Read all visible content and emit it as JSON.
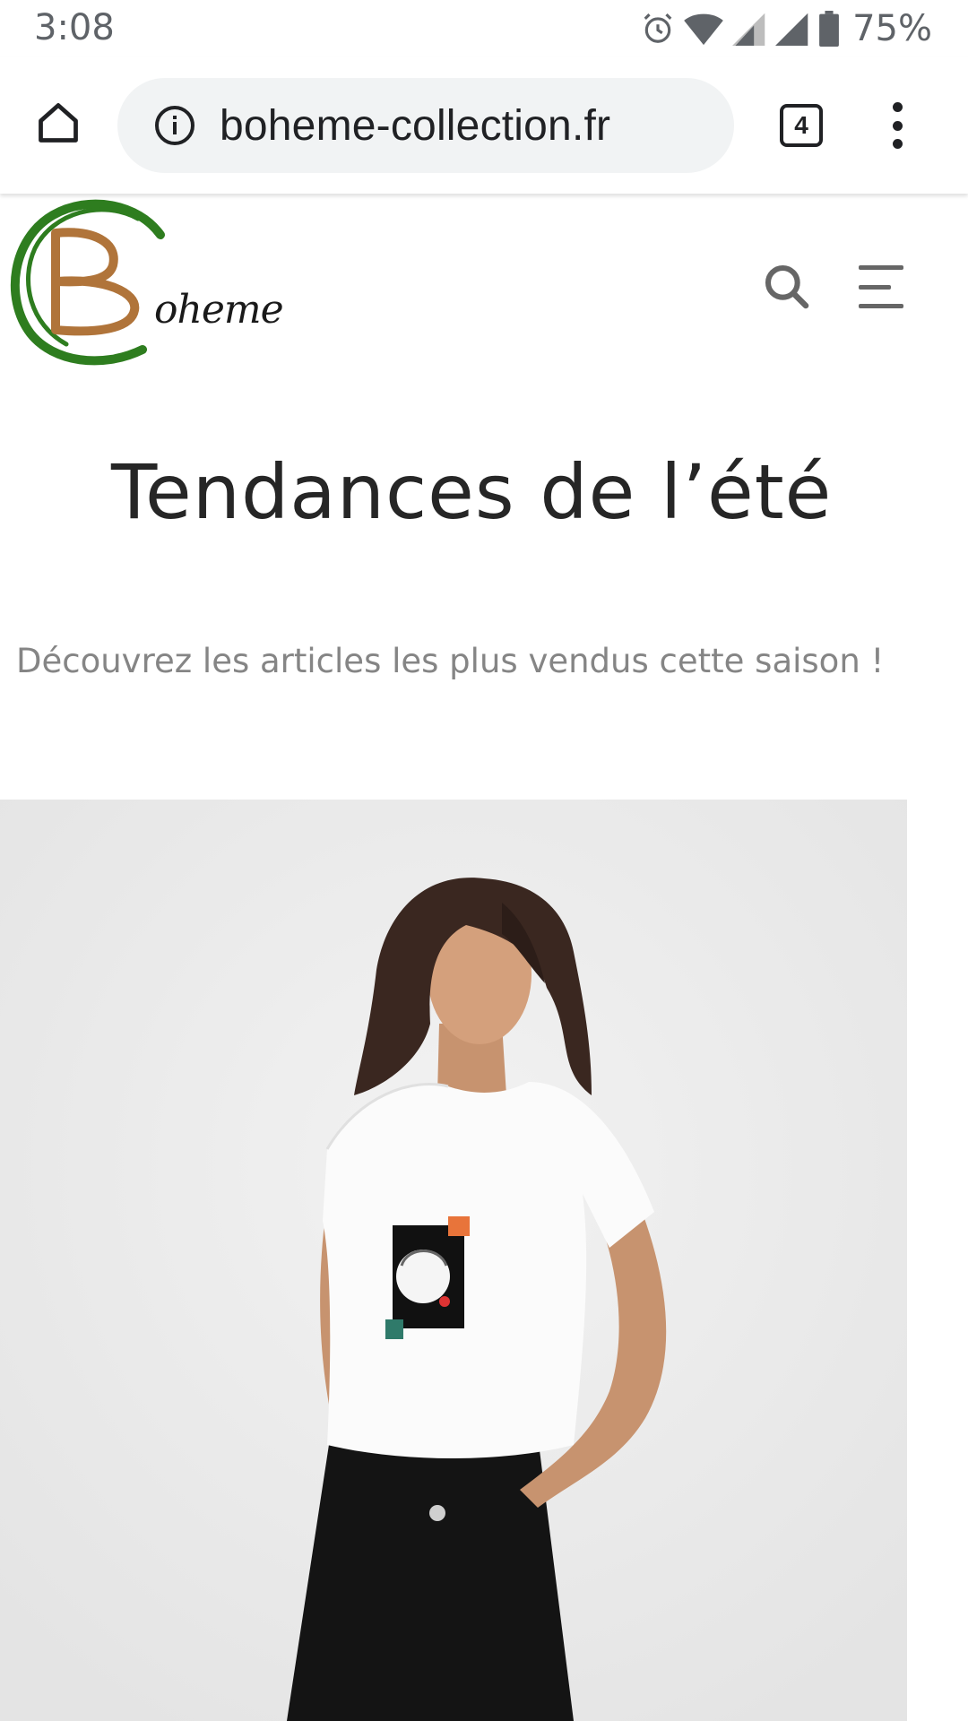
{
  "status_bar": {
    "time": "3:08",
    "battery": "75%"
  },
  "browser": {
    "url": "boheme-collection.fr",
    "tab_count": "4"
  },
  "site": {
    "logo_text": "oheme",
    "logo_initial": "B",
    "colors": {
      "logo_green": "#2e7d1f",
      "logo_brown": "#b0743a"
    }
  },
  "content": {
    "title": "Tendances de l’été",
    "subtitle": "Découvrez les articles les plus vendus cette saison !"
  },
  "icons": [
    "home-icon",
    "info-icon",
    "tabs-icon",
    "more-vert-icon",
    "search-icon",
    "menu-icon",
    "alarm-icon",
    "wifi-icon",
    "signal-icon",
    "battery-icon"
  ]
}
